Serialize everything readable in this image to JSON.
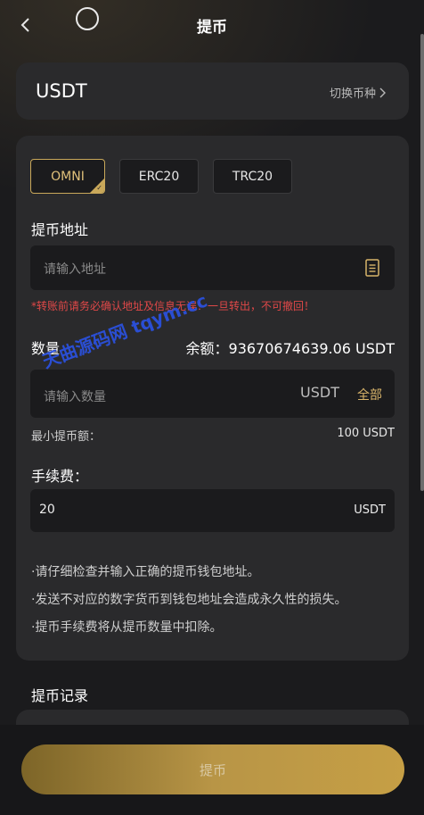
{
  "header": {
    "title": "提币"
  },
  "currency": {
    "name": "USDT",
    "switch_label": "切换币种"
  },
  "chains": [
    {
      "label": "OMNI",
      "active": true
    },
    {
      "label": "ERC20",
      "active": false
    },
    {
      "label": "TRC20",
      "active": false
    }
  ],
  "address": {
    "label": "提币地址",
    "placeholder": "请输入地址",
    "warning": "*转账前请务必确认地址及信息无误！一旦转出，不可撤回！"
  },
  "amount": {
    "label": "数量",
    "balance": "余额：93670674639.06 USDT",
    "placeholder": "请输入数量",
    "unit": "USDT",
    "all_label": "全部",
    "min_label": "最小提币额：",
    "min_value": "100 USDT"
  },
  "fee": {
    "label": "手续费：",
    "value": "20",
    "unit": "USDT"
  },
  "notes": [
    "·请仔细检查并输入正确的提币钱包地址。",
    "·发送不对应的数字货币到钱包地址会造成永久性的损失。",
    "·提币手续费将从提币数量中扣除。"
  ],
  "records": {
    "title": "提币记录"
  },
  "submit": {
    "label": "提币"
  },
  "watermark": "天曲源码网 tqym.cc",
  "colors": {
    "background": "#1b1b1d",
    "card": "#2a2a2c",
    "accent_gold": "#c9a85a",
    "warning_red": "#e04848"
  }
}
